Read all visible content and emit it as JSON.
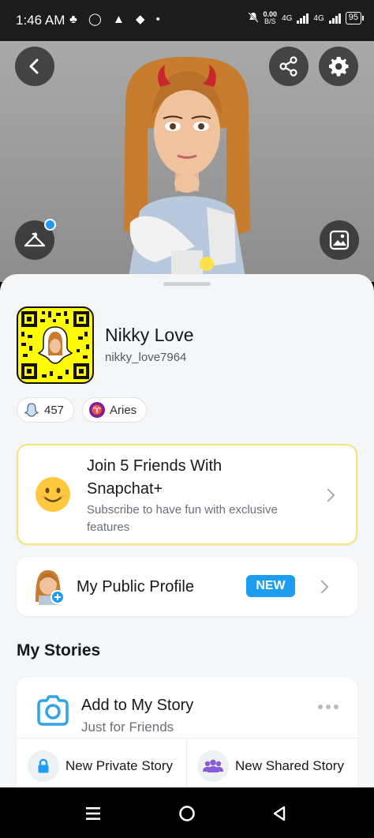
{
  "status_bar": {
    "time": "1:46 AM",
    "notification_icons": "♣ ◯ ▲ ◆ •",
    "speed_value": "0.00",
    "speed_unit": "B/S",
    "network_1": "4G",
    "network_2": "4G",
    "battery": "95"
  },
  "profile": {
    "display_name": "Nikky Love",
    "username": "nikky_love7964",
    "snapscore": "457",
    "zodiac": "Aries",
    "zodiac_symbol": "♈"
  },
  "snapchat_plus": {
    "title": "Join 5 Friends With Snapchat+",
    "subtitle": "Subscribe to have fun with exclusive features"
  },
  "public_profile": {
    "label": "My Public Profile",
    "badge": "NEW"
  },
  "stories": {
    "section_title": "My Stories",
    "add_label": "Add to My Story",
    "add_sub": "Just for Friends",
    "private_label": "New Private Story",
    "shared_label": "New Shared Story"
  },
  "colors": {
    "snap_yellow": "#fffc00",
    "accent_blue": "#1e9cf0",
    "camera_blue": "#2fa3e6"
  },
  "icons": {
    "back": "arrow-left",
    "share": "share-nodes",
    "settings": "gear",
    "outfit": "hanger",
    "background": "image",
    "score": "ghost",
    "zodiac": "aries",
    "plus": "smiley",
    "camera": "camera",
    "lock": "lock",
    "group": "people"
  }
}
